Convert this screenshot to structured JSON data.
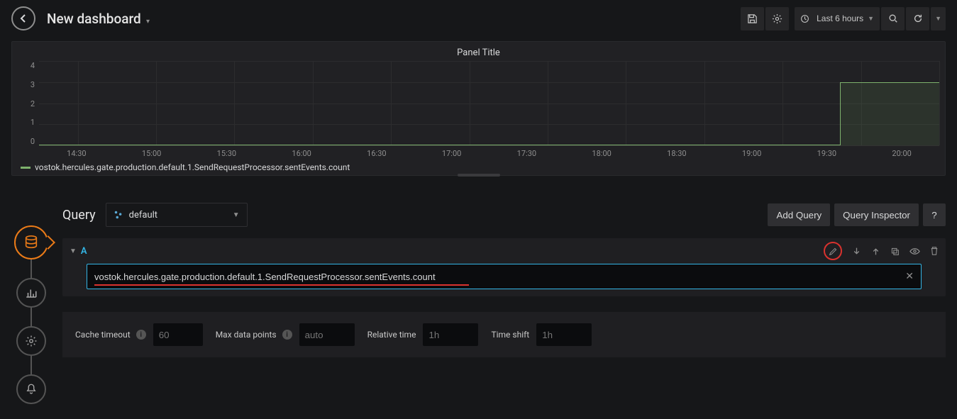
{
  "header": {
    "title": "New dashboard",
    "time_range": "Last 6 hours"
  },
  "panel": {
    "title": "Panel Title",
    "legend": "vostok.hercules.gate.production.default.1.SendRequestProcessor.sentEvents.count"
  },
  "chart_data": {
    "type": "line",
    "title": "Panel Title",
    "xlabel": "",
    "ylabel": "",
    "ylim": [
      0,
      4
    ],
    "y_ticks": [
      "4",
      "3",
      "2",
      "1",
      "0"
    ],
    "x_ticks": [
      "14:30",
      "15:00",
      "15:30",
      "16:00",
      "16:30",
      "17:00",
      "17:30",
      "18:00",
      "18:30",
      "19:00",
      "19:30",
      "20:00"
    ],
    "series": [
      {
        "name": "vostok.hercules.gate.production.default.1.SendRequestProcessor.sentEvents.count",
        "color": "#7eb26d",
        "x": [
          "14:30",
          "15:00",
          "15:30",
          "16:00",
          "16:30",
          "17:00",
          "17:30",
          "18:00",
          "18:30",
          "19:00",
          "19:25",
          "19:30",
          "20:00",
          "20:15"
        ],
        "y": [
          0,
          0,
          0,
          0,
          0,
          0,
          0,
          0,
          0,
          0,
          0,
          3,
          3,
          3
        ]
      }
    ]
  },
  "query": {
    "section_title": "Query",
    "datasource": "default",
    "add_btn": "Add Query",
    "inspector_btn": "Query Inspector",
    "help_btn": "?",
    "row_letter": "A",
    "text": "vostok.hercules.gate.production.default.1.SendRequestProcessor.sentEvents.count"
  },
  "options": {
    "cache_timeout": {
      "label": "Cache timeout",
      "placeholder": "60",
      "value": ""
    },
    "max_data_points": {
      "label": "Max data points",
      "placeholder": "auto",
      "value": ""
    },
    "relative_time": {
      "label": "Relative time",
      "placeholder": "1h",
      "value": ""
    },
    "time_shift": {
      "label": "Time shift",
      "placeholder": "1h",
      "value": ""
    }
  }
}
